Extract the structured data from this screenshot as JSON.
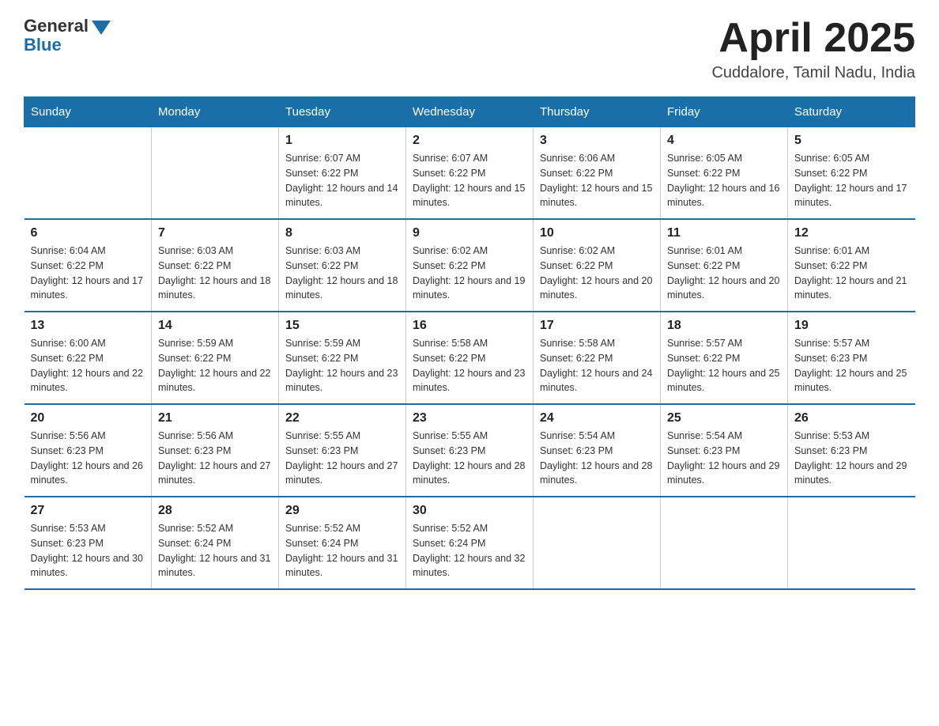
{
  "header": {
    "logo_general": "General",
    "logo_blue": "Blue",
    "month_title": "April 2025",
    "location": "Cuddalore, Tamil Nadu, India"
  },
  "weekdays": [
    "Sunday",
    "Monday",
    "Tuesday",
    "Wednesday",
    "Thursday",
    "Friday",
    "Saturday"
  ],
  "weeks": [
    [
      {
        "day": "",
        "sunrise": "",
        "sunset": "",
        "daylight": ""
      },
      {
        "day": "",
        "sunrise": "",
        "sunset": "",
        "daylight": ""
      },
      {
        "day": "1",
        "sunrise": "Sunrise: 6:07 AM",
        "sunset": "Sunset: 6:22 PM",
        "daylight": "Daylight: 12 hours and 14 minutes."
      },
      {
        "day": "2",
        "sunrise": "Sunrise: 6:07 AM",
        "sunset": "Sunset: 6:22 PM",
        "daylight": "Daylight: 12 hours and 15 minutes."
      },
      {
        "day": "3",
        "sunrise": "Sunrise: 6:06 AM",
        "sunset": "Sunset: 6:22 PM",
        "daylight": "Daylight: 12 hours and 15 minutes."
      },
      {
        "day": "4",
        "sunrise": "Sunrise: 6:05 AM",
        "sunset": "Sunset: 6:22 PM",
        "daylight": "Daylight: 12 hours and 16 minutes."
      },
      {
        "day": "5",
        "sunrise": "Sunrise: 6:05 AM",
        "sunset": "Sunset: 6:22 PM",
        "daylight": "Daylight: 12 hours and 17 minutes."
      }
    ],
    [
      {
        "day": "6",
        "sunrise": "Sunrise: 6:04 AM",
        "sunset": "Sunset: 6:22 PM",
        "daylight": "Daylight: 12 hours and 17 minutes."
      },
      {
        "day": "7",
        "sunrise": "Sunrise: 6:03 AM",
        "sunset": "Sunset: 6:22 PM",
        "daylight": "Daylight: 12 hours and 18 minutes."
      },
      {
        "day": "8",
        "sunrise": "Sunrise: 6:03 AM",
        "sunset": "Sunset: 6:22 PM",
        "daylight": "Daylight: 12 hours and 18 minutes."
      },
      {
        "day": "9",
        "sunrise": "Sunrise: 6:02 AM",
        "sunset": "Sunset: 6:22 PM",
        "daylight": "Daylight: 12 hours and 19 minutes."
      },
      {
        "day": "10",
        "sunrise": "Sunrise: 6:02 AM",
        "sunset": "Sunset: 6:22 PM",
        "daylight": "Daylight: 12 hours and 20 minutes."
      },
      {
        "day": "11",
        "sunrise": "Sunrise: 6:01 AM",
        "sunset": "Sunset: 6:22 PM",
        "daylight": "Daylight: 12 hours and 20 minutes."
      },
      {
        "day": "12",
        "sunrise": "Sunrise: 6:01 AM",
        "sunset": "Sunset: 6:22 PM",
        "daylight": "Daylight: 12 hours and 21 minutes."
      }
    ],
    [
      {
        "day": "13",
        "sunrise": "Sunrise: 6:00 AM",
        "sunset": "Sunset: 6:22 PM",
        "daylight": "Daylight: 12 hours and 22 minutes."
      },
      {
        "day": "14",
        "sunrise": "Sunrise: 5:59 AM",
        "sunset": "Sunset: 6:22 PM",
        "daylight": "Daylight: 12 hours and 22 minutes."
      },
      {
        "day": "15",
        "sunrise": "Sunrise: 5:59 AM",
        "sunset": "Sunset: 6:22 PM",
        "daylight": "Daylight: 12 hours and 23 minutes."
      },
      {
        "day": "16",
        "sunrise": "Sunrise: 5:58 AM",
        "sunset": "Sunset: 6:22 PM",
        "daylight": "Daylight: 12 hours and 23 minutes."
      },
      {
        "day": "17",
        "sunrise": "Sunrise: 5:58 AM",
        "sunset": "Sunset: 6:22 PM",
        "daylight": "Daylight: 12 hours and 24 minutes."
      },
      {
        "day": "18",
        "sunrise": "Sunrise: 5:57 AM",
        "sunset": "Sunset: 6:22 PM",
        "daylight": "Daylight: 12 hours and 25 minutes."
      },
      {
        "day": "19",
        "sunrise": "Sunrise: 5:57 AM",
        "sunset": "Sunset: 6:23 PM",
        "daylight": "Daylight: 12 hours and 25 minutes."
      }
    ],
    [
      {
        "day": "20",
        "sunrise": "Sunrise: 5:56 AM",
        "sunset": "Sunset: 6:23 PM",
        "daylight": "Daylight: 12 hours and 26 minutes."
      },
      {
        "day": "21",
        "sunrise": "Sunrise: 5:56 AM",
        "sunset": "Sunset: 6:23 PM",
        "daylight": "Daylight: 12 hours and 27 minutes."
      },
      {
        "day": "22",
        "sunrise": "Sunrise: 5:55 AM",
        "sunset": "Sunset: 6:23 PM",
        "daylight": "Daylight: 12 hours and 27 minutes."
      },
      {
        "day": "23",
        "sunrise": "Sunrise: 5:55 AM",
        "sunset": "Sunset: 6:23 PM",
        "daylight": "Daylight: 12 hours and 28 minutes."
      },
      {
        "day": "24",
        "sunrise": "Sunrise: 5:54 AM",
        "sunset": "Sunset: 6:23 PM",
        "daylight": "Daylight: 12 hours and 28 minutes."
      },
      {
        "day": "25",
        "sunrise": "Sunrise: 5:54 AM",
        "sunset": "Sunset: 6:23 PM",
        "daylight": "Daylight: 12 hours and 29 minutes."
      },
      {
        "day": "26",
        "sunrise": "Sunrise: 5:53 AM",
        "sunset": "Sunset: 6:23 PM",
        "daylight": "Daylight: 12 hours and 29 minutes."
      }
    ],
    [
      {
        "day": "27",
        "sunrise": "Sunrise: 5:53 AM",
        "sunset": "Sunset: 6:23 PM",
        "daylight": "Daylight: 12 hours and 30 minutes."
      },
      {
        "day": "28",
        "sunrise": "Sunrise: 5:52 AM",
        "sunset": "Sunset: 6:24 PM",
        "daylight": "Daylight: 12 hours and 31 minutes."
      },
      {
        "day": "29",
        "sunrise": "Sunrise: 5:52 AM",
        "sunset": "Sunset: 6:24 PM",
        "daylight": "Daylight: 12 hours and 31 minutes."
      },
      {
        "day": "30",
        "sunrise": "Sunrise: 5:52 AM",
        "sunset": "Sunset: 6:24 PM",
        "daylight": "Daylight: 12 hours and 32 minutes."
      },
      {
        "day": "",
        "sunrise": "",
        "sunset": "",
        "daylight": ""
      },
      {
        "day": "",
        "sunrise": "",
        "sunset": "",
        "daylight": ""
      },
      {
        "day": "",
        "sunrise": "",
        "sunset": "",
        "daylight": ""
      }
    ]
  ]
}
